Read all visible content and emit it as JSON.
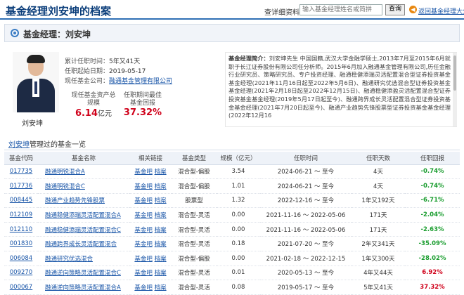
{
  "header": {
    "title": "基金经理刘安坤的档案",
    "query_label": "查详细资料：",
    "search_placeholder": "输入基金经理姓名或简拼",
    "search_button": "查询",
    "back_link": "返回基金经理大全"
  },
  "manager": {
    "label": "基金经理：刘安坤",
    "name": "刘安坤",
    "tenure_label": "累计任职时间：",
    "tenure": "5年又41天",
    "start_label": "任职起始日期：",
    "start": "2019-05-17",
    "company_label": "现任基金公司：",
    "company": "融通基金管理有限公司",
    "scale_label": "现任基金资产总规模",
    "scale_value": "6.14",
    "scale_unit": "亿元",
    "return_label": "任职期间最佳基金回报",
    "return_value": "37.32%"
  },
  "bio": {
    "title": "基金经理简介：",
    "text": "刘安坤先生 中国国籍,武汉大学金融学硕士,2013年7月至2015年6月就职于长江证券股份有限公司任分析师。2015年6月加入融通基金管理有限公司,历任金融行业研究员、策略研究员、专户投资经理、融通稳健添瑞灵活配置混合型证券投资基金基金经理(2021年11月16日起至2022年5月6日)、融通研究优选混合型证券投资基金基金经理(2021年2月18日起至2022年12月15日)、融通稳健添盈灵活配置混合型证券投资基金基金经理(2019年5月17日起至今)、融通跨界成长灵活配置混合型证券投资基金基金经理(2021年7月20日起至今)、融通产业趋势先锋股票型证券投资基金基金经理(2022年12月16"
  },
  "funds": {
    "title_name": "刘安坤",
    "title_rest": "管理过的基金一览",
    "columns": [
      "基金代码",
      "基金名称",
      "相关链接",
      "基金类型",
      "规模（亿元）",
      "任职时间",
      "任职天数",
      "任职回报"
    ],
    "link1": "基金吧",
    "link2": "档案",
    "rows": [
      {
        "code": "017735",
        "name": "融通明锐混合A",
        "type": "混合型-偏股",
        "scale": "3.54",
        "period": "2024-06-21 ～ 至今",
        "days": "4天",
        "ret": "-0.74%",
        "dir": "down"
      },
      {
        "code": "017736",
        "name": "融通明锐混合C",
        "type": "混合型-偏股",
        "scale": "1.01",
        "period": "2024-06-21 ～ 至今",
        "days": "4天",
        "ret": "-0.74%",
        "dir": "down"
      },
      {
        "code": "008445",
        "name": "融通产业趋势先锋股票",
        "type": "股票型",
        "scale": "1.32",
        "period": "2022-12-16 ～ 至今",
        "days": "1年又192天",
        "ret": "-6.71%",
        "dir": "down"
      },
      {
        "code": "012109",
        "name": "融通稳健添瑞灵活配置混合A",
        "type": "混合型-灵活",
        "scale": "0.00",
        "period": "2021-11-16 ～ 2022-05-06",
        "days": "171天",
        "ret": "-2.04%",
        "dir": "down"
      },
      {
        "code": "012110",
        "name": "融通稳健添瑞灵活配置混合C",
        "type": "混合型-灵活",
        "scale": "0.00",
        "period": "2021-11-16 ～ 2022-05-06",
        "days": "171天",
        "ret": "-2.63%",
        "dir": "down"
      },
      {
        "code": "001830",
        "name": "融通跨界成长灵活配置混合",
        "type": "混合型-灵活",
        "scale": "0.18",
        "period": "2021-07-20 ～ 至今",
        "days": "2年又341天",
        "ret": "-35.09%",
        "dir": "down"
      },
      {
        "code": "006084",
        "name": "融通研究优选混合",
        "type": "混合型-偏股",
        "scale": "0.00",
        "period": "2021-02-18 ～ 2022-12-15",
        "days": "1年又300天",
        "ret": "-28.02%",
        "dir": "down"
      },
      {
        "code": "009270",
        "name": "融通逆向策略灵活配置混合C",
        "type": "混合型-灵活",
        "scale": "0.01",
        "period": "2020-05-13 ～ 至今",
        "days": "4年又44天",
        "ret": "6.92%",
        "dir": "up"
      },
      {
        "code": "000067",
        "name": "融通逆向策略灵活配置混合A",
        "type": "混合型-灵活",
        "scale": "0.08",
        "period": "2019-05-17 ～ 至今",
        "days": "5年又41天",
        "ret": "37.32%",
        "dir": "up"
      }
    ]
  },
  "colors": {
    "brand": "#0a3d7a",
    "accent": "#2f6fb5",
    "up": "#d0021b",
    "down": "#1a9d2f"
  },
  "icons": {
    "back": "back-arrow-icon",
    "manager": "user-circle-icon"
  }
}
